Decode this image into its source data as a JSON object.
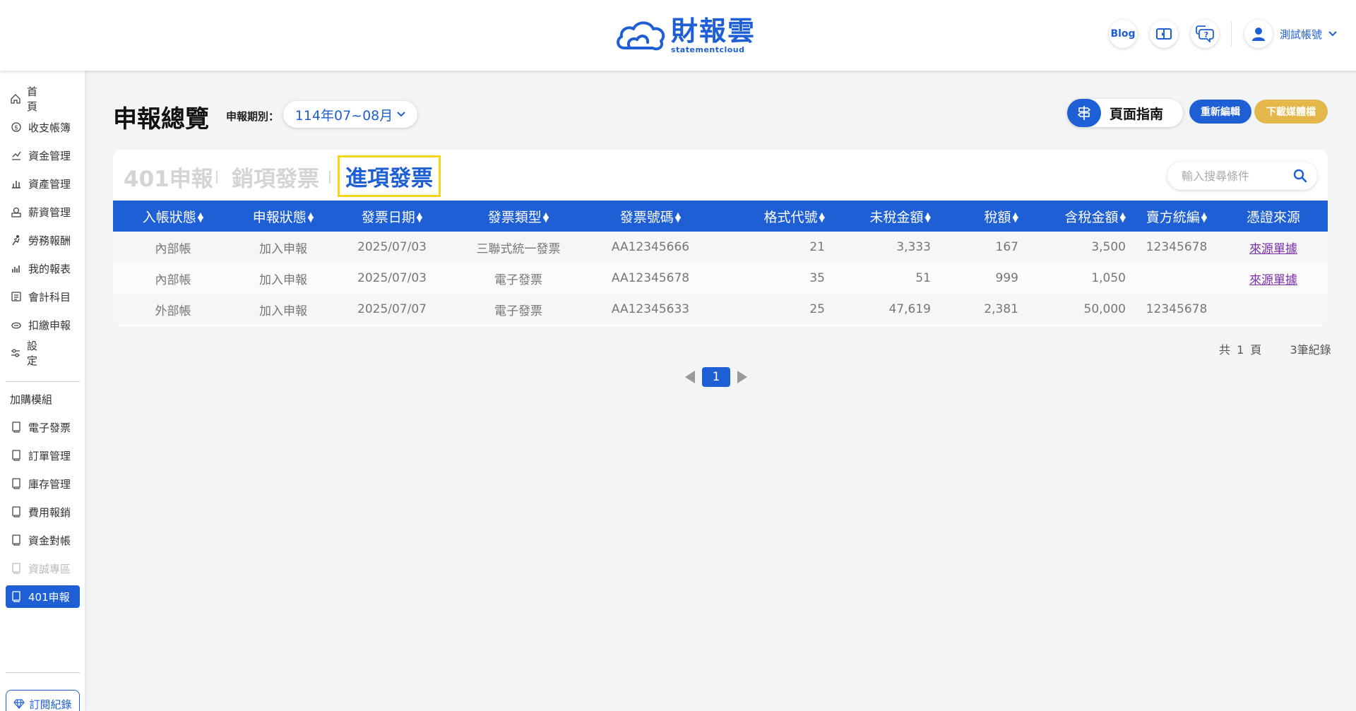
{
  "header": {
    "logo_text": "財報雲",
    "logo_sub": "statementcloud",
    "blog_label": "Blog",
    "account_name": "測試帳號"
  },
  "sidebar": {
    "main_items": [
      {
        "label": "首頁",
        "icon": "home-icon"
      },
      {
        "label": "收支帳簿",
        "icon": "coin-icon"
      },
      {
        "label": "資金管理",
        "icon": "fund-icon"
      },
      {
        "label": "資產管理",
        "icon": "asset-icon"
      },
      {
        "label": "薪資管理",
        "icon": "salary-icon"
      },
      {
        "label": "勞務報酬",
        "icon": "labor-icon"
      },
      {
        "label": "我的報表",
        "icon": "report-icon"
      },
      {
        "label": "會計科目",
        "icon": "ledger-icon"
      },
      {
        "label": "扣繳申報",
        "icon": "withholding-icon"
      },
      {
        "label": "設定",
        "icon": "settings-icon"
      }
    ],
    "addon_heading": "加購模組",
    "addon_items": [
      {
        "label": "電子發票",
        "icon": "book-icon"
      },
      {
        "label": "訂單管理",
        "icon": "book-icon"
      },
      {
        "label": "庫存管理",
        "icon": "book-icon"
      },
      {
        "label": "費用報銷",
        "icon": "book-icon"
      },
      {
        "label": "資金對帳",
        "icon": "book-icon"
      },
      {
        "label": "資誠專區",
        "icon": "book-icon"
      },
      {
        "label": "401申報",
        "icon": "book-icon"
      }
    ],
    "subscribe_label": "訂閱紀錄"
  },
  "page": {
    "title": "申報總覽",
    "period_label": "申報期別：",
    "period_value": "114年07~08月",
    "guide_label": "頁面指南",
    "reedit_label": "重新編輯",
    "download_label": "下載媒體檔"
  },
  "tabs": [
    "401申報",
    "銷項發票",
    "進項發票"
  ],
  "active_tab": "進項發票",
  "search": {
    "placeholder": "輸入搜尋條件"
  },
  "table": {
    "columns": [
      "入帳狀態",
      "申報狀態",
      "發票日期",
      "發票類型",
      "發票號碼",
      "格式代號",
      "未稅金額",
      "稅額",
      "含稅金額",
      "賣方統編",
      "憑證來源"
    ],
    "rows": [
      [
        "內部帳",
        "加入申報",
        "2025/07/03",
        "三聯式統一發票",
        "AA12345666",
        "21",
        "3,333",
        "167",
        "3,500",
        "12345678",
        "來源單據"
      ],
      [
        "內部帳",
        "加入申報",
        "2025/07/03",
        "電子發票",
        "AA12345678",
        "35",
        "51",
        "999",
        "1,050",
        "",
        "來源單據"
      ],
      [
        "外部帳",
        "加入申報",
        "2025/07/07",
        "電子發票",
        "AA12345633",
        "25",
        "47,619",
        "2,381",
        "50,000",
        "12345678",
        ""
      ]
    ]
  },
  "summary": {
    "pages": "共 1 頁",
    "records": "3筆紀錄"
  },
  "pagination": {
    "current": "1"
  },
  "colors": {
    "primary": "#1f5fd6",
    "gold": "#e4b74a",
    "highlight": "#f7d617",
    "link": "#7a2fa8"
  }
}
